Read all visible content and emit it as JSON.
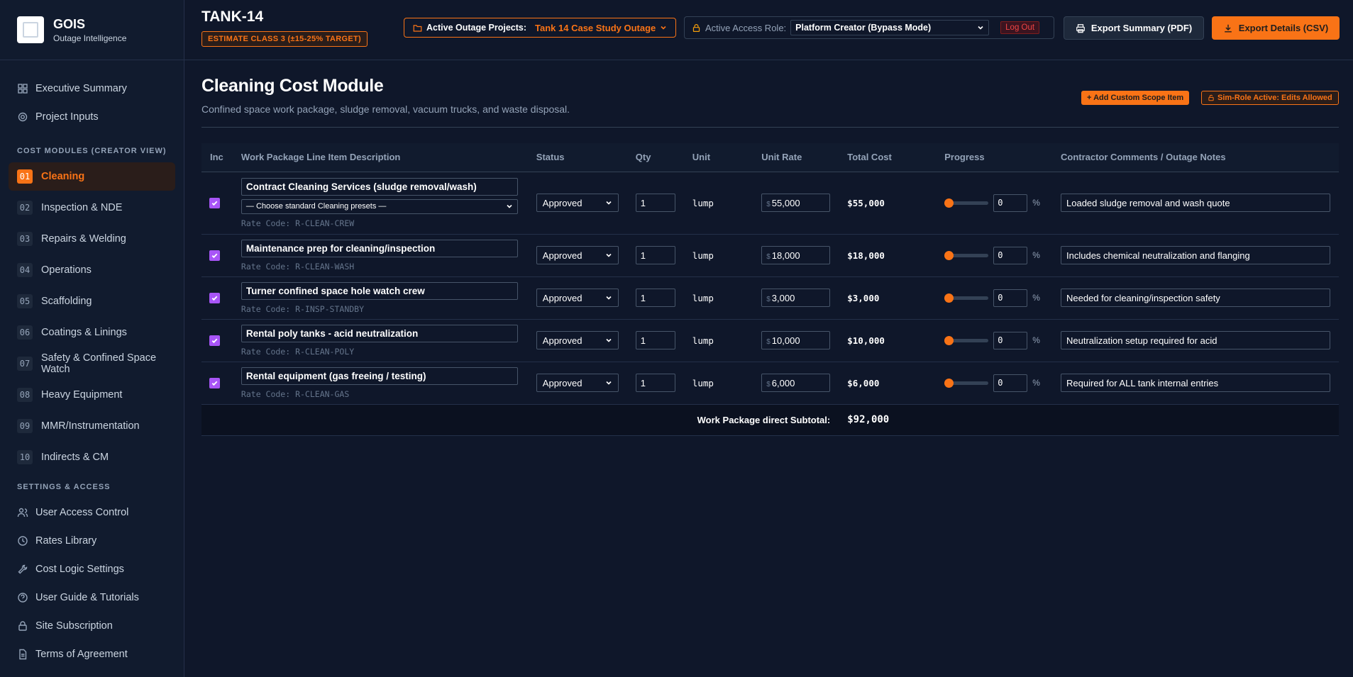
{
  "brand": {
    "name": "GOIS",
    "subtitle": "Outage Intelligence"
  },
  "sidebar": {
    "top_items": [
      {
        "label": "Executive Summary",
        "icon": "grid-icon"
      },
      {
        "label": "Project Inputs",
        "icon": "gear-icon"
      }
    ],
    "modules_heading": "COST MODULES (CREATOR VIEW)",
    "modules": [
      {
        "num": "01",
        "label": "Cleaning",
        "active": true
      },
      {
        "num": "02",
        "label": "Inspection & NDE"
      },
      {
        "num": "03",
        "label": "Repairs & Welding"
      },
      {
        "num": "04",
        "label": "Operations"
      },
      {
        "num": "05",
        "label": "Scaffolding"
      },
      {
        "num": "06",
        "label": "Coatings & Linings"
      },
      {
        "num": "07",
        "label": "Safety & Confined Space Watch"
      },
      {
        "num": "08",
        "label": "Heavy Equipment"
      },
      {
        "num": "09",
        "label": "MMR/Instrumentation"
      },
      {
        "num": "10",
        "label": "Indirects & CM"
      }
    ],
    "settings_heading": "SETTINGS & ACCESS",
    "settings": [
      {
        "label": "User Access Control",
        "icon": "users-icon"
      },
      {
        "label": "Rates Library",
        "icon": "clock-icon"
      },
      {
        "label": "Cost Logic Settings",
        "icon": "wrench-icon"
      },
      {
        "label": "User Guide & Tutorials",
        "icon": "help-icon"
      },
      {
        "label": "Site Subscription",
        "icon": "lock-icon"
      },
      {
        "label": "Terms of Agreement",
        "icon": "document-icon"
      }
    ]
  },
  "header": {
    "tank": "TANK-14",
    "class_badge": "ESTIMATE CLASS 3 (±15-25% TARGET)",
    "outage_label": "Active Outage Projects:",
    "outage_value": "Tank 14 Case Study Outage",
    "role_label": "Active Access Role:",
    "role_value": "Platform Creator (Bypass Mode)",
    "logout": "Log Out",
    "export_pdf": "Export Summary (PDF)",
    "export_csv": "Export Details (CSV)"
  },
  "page": {
    "title": "Cleaning Cost Module",
    "subtitle": "Confined space work package, sludge removal, vacuum trucks, and waste disposal.",
    "add_button": "+ Add Custom Scope Item",
    "sim_badge": "Sim-Role Active: Edits Allowed"
  },
  "table": {
    "headers": [
      "Inc",
      "Work Package Line Item Description",
      "Status",
      "Qty",
      "Unit",
      "Unit Rate",
      "Total Cost",
      "Progress",
      "Contractor Comments / Outage Notes"
    ],
    "preset_placeholder": "— Choose standard Cleaning presets —",
    "rows": [
      {
        "desc": "Contract Cleaning Services (sludge removal/wash)",
        "rate_code": "Rate Code: R-CLEAN-CREW",
        "status": "Approved",
        "qty": "1",
        "unit": "lump",
        "currency": "$",
        "unit_rate": "55,000",
        "total": "$55,000",
        "progress": "0",
        "pct": "%",
        "comment": "Loaded sludge removal and wash quote",
        "has_preset": true
      },
      {
        "desc": "Maintenance prep for cleaning/inspection",
        "rate_code": "Rate Code: R-CLEAN-WASH",
        "status": "Approved",
        "qty": "1",
        "unit": "lump",
        "currency": "$",
        "unit_rate": "18,000",
        "total": "$18,000",
        "progress": "0",
        "pct": "%",
        "comment": "Includes chemical neutralization and flanging"
      },
      {
        "desc": "Turner confined space hole watch crew",
        "rate_code": "Rate Code: R-INSP-STANDBY",
        "status": "Approved",
        "qty": "1",
        "unit": "lump",
        "currency": "$",
        "unit_rate": "3,000",
        "total": "$3,000",
        "progress": "0",
        "pct": "%",
        "comment": "Needed for cleaning/inspection safety"
      },
      {
        "desc": "Rental poly tanks - acid neutralization",
        "rate_code": "Rate Code: R-CLEAN-POLY",
        "status": "Approved",
        "qty": "1",
        "unit": "lump",
        "currency": "$",
        "unit_rate": "10,000",
        "total": "$10,000",
        "progress": "0",
        "pct": "%",
        "comment": "Neutralization setup required for acid"
      },
      {
        "desc": "Rental equipment (gas freeing / testing)",
        "rate_code": "Rate Code: R-CLEAN-GAS",
        "status": "Approved",
        "qty": "1",
        "unit": "lump",
        "currency": "$",
        "unit_rate": "6,000",
        "total": "$6,000",
        "progress": "0",
        "pct": "%",
        "comment": "Required for ALL tank internal entries"
      }
    ],
    "subtotal_label": "Work Package direct Subtotal:",
    "subtotal_value": "$92,000"
  },
  "colors": {
    "accent": "#f97316",
    "checkbox": "#a855f7",
    "background": "#0f172a"
  }
}
